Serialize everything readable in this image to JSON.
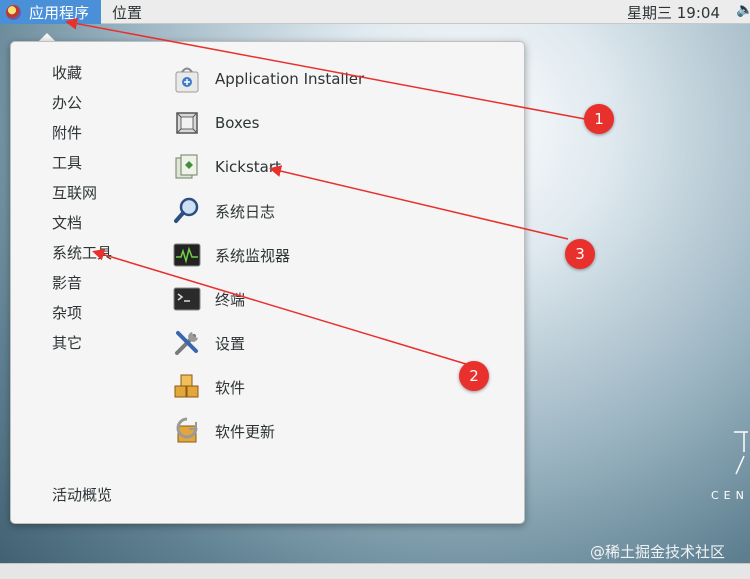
{
  "topbar": {
    "apps_label": "应用程序",
    "places_label": "位置",
    "clock": "星期三 19:04",
    "volume_icon": "speaker-icon"
  },
  "menu": {
    "categories": [
      "收藏",
      "办公",
      "附件",
      "工具",
      "互联网",
      "文档",
      "系统工具",
      "影音",
      "杂项",
      "其它"
    ],
    "activities": "活动概览",
    "apps": [
      {
        "label": "Application Installer",
        "icon": "application-installer-icon"
      },
      {
        "label": "Boxes",
        "icon": "boxes-icon"
      },
      {
        "label": "Kickstart",
        "icon": "kickstart-icon"
      },
      {
        "label": "系统日志",
        "icon": "system-log-icon"
      },
      {
        "label": "系统监视器",
        "icon": "system-monitor-icon"
      },
      {
        "label": "终端",
        "icon": "terminal-icon"
      },
      {
        "label": "设置",
        "icon": "settings-icon"
      },
      {
        "label": "软件",
        "icon": "software-icon"
      },
      {
        "label": "软件更新",
        "icon": "software-update-icon"
      }
    ]
  },
  "annotations": [
    "1",
    "2",
    "3"
  ],
  "desktop": {
    "logo_text": "CEN",
    "watermark": "@稀土掘金技术社区"
  },
  "colors": {
    "accent": "#4a90d9",
    "annotation": "#e8302d"
  }
}
